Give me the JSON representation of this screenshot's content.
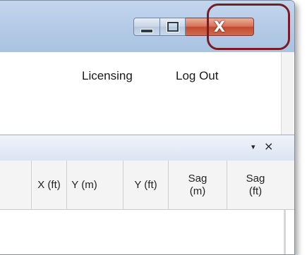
{
  "window": {
    "caption_buttons": {
      "minimize_icon": "minimize-icon",
      "maximize_icon": "maximize-icon",
      "close_glyph": "X"
    },
    "colors": {
      "highlight_ring": "#7a1c28",
      "close_button": "#c24a30",
      "titlebar": "#b5cbe6"
    }
  },
  "menu": {
    "licensing": "Licensing",
    "logout": "Log Out"
  },
  "panel": {
    "dropdown_glyph": "▾",
    "close_glyph": "×"
  },
  "grid": {
    "columns": [
      {
        "label": "X (ft)"
      },
      {
        "label": "Y (m)"
      },
      {
        "label": "Y (ft)"
      },
      {
        "label": "Sag\n(m)"
      },
      {
        "label": "Sag\n(ft)"
      }
    ]
  }
}
